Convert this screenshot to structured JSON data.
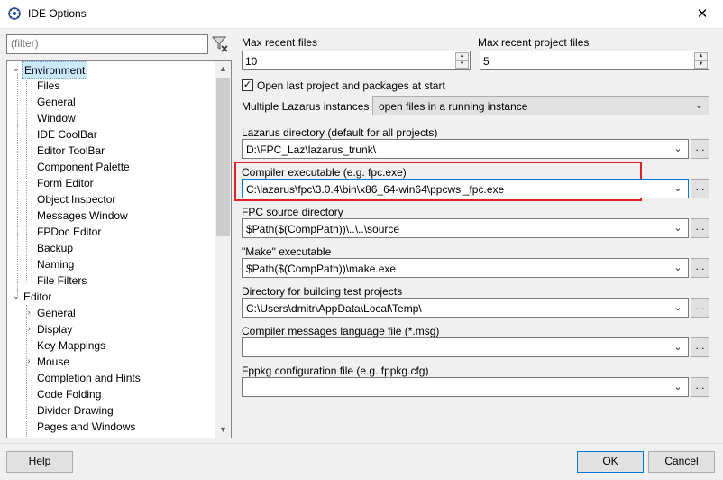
{
  "window": {
    "title": "IDE Options",
    "close_glyph": "✕"
  },
  "filter": {
    "placeholder": "(filter)"
  },
  "tree": {
    "environment": {
      "label": "Environment",
      "children": [
        "Files",
        "General",
        "Window",
        "IDE CoolBar",
        "Editor ToolBar",
        "Component Palette",
        "Form Editor",
        "Object Inspector",
        "Messages Window",
        "FPDoc Editor",
        "Backup",
        "Naming",
        "File Filters"
      ]
    },
    "editor": {
      "label": "Editor",
      "children": [
        "General",
        "Display",
        "Key Mappings",
        "Mouse",
        "Completion and Hints",
        "Code Folding",
        "Divider Drawing",
        "Pages and Windows"
      ]
    }
  },
  "fields": {
    "max_recent_files": {
      "label": "Max recent files",
      "value": "10"
    },
    "max_recent_project_files": {
      "label": "Max recent project files",
      "value": "5"
    },
    "open_last_project": {
      "label": "Open last project and packages at start",
      "checked": true,
      "check_glyph": "✓"
    },
    "multiple_instances": {
      "label": "Multiple Lazarus instances",
      "value": "open files in a running instance"
    },
    "lazarus_dir": {
      "label": "Lazarus directory (default for all projects)",
      "value": "D:\\FPC_Laz\\lazarus_trunk\\"
    },
    "compiler_exe": {
      "label": "Compiler executable (e.g. fpc.exe)",
      "value": "C:\\lazarus\\fpc\\3.0.4\\bin\\x86_64-win64\\ppcwsl_fpc.exe"
    },
    "fpc_source": {
      "label": "FPC source directory",
      "value": "$Path($(CompPath))\\..\\..\\source"
    },
    "make_exe": {
      "label": "\"Make\" executable",
      "value": "$Path($(CompPath))\\make.exe"
    },
    "test_dir": {
      "label": "Directory for building test projects",
      "value": "C:\\Users\\dmitr\\AppData\\Local\\Temp\\"
    },
    "messages_file": {
      "label": "Compiler messages language file (*.msg)",
      "value": ""
    },
    "fppkg_file": {
      "label": "Fppkg configuration file (e.g. fppkg.cfg)",
      "value": ""
    }
  },
  "browse_label": "...",
  "buttons": {
    "help": "Help",
    "ok": "OK",
    "cancel": "Cancel"
  },
  "colors": {
    "highlight_border": "#e0202a",
    "selection": "#cce8ff",
    "focus": "#0078d7"
  }
}
